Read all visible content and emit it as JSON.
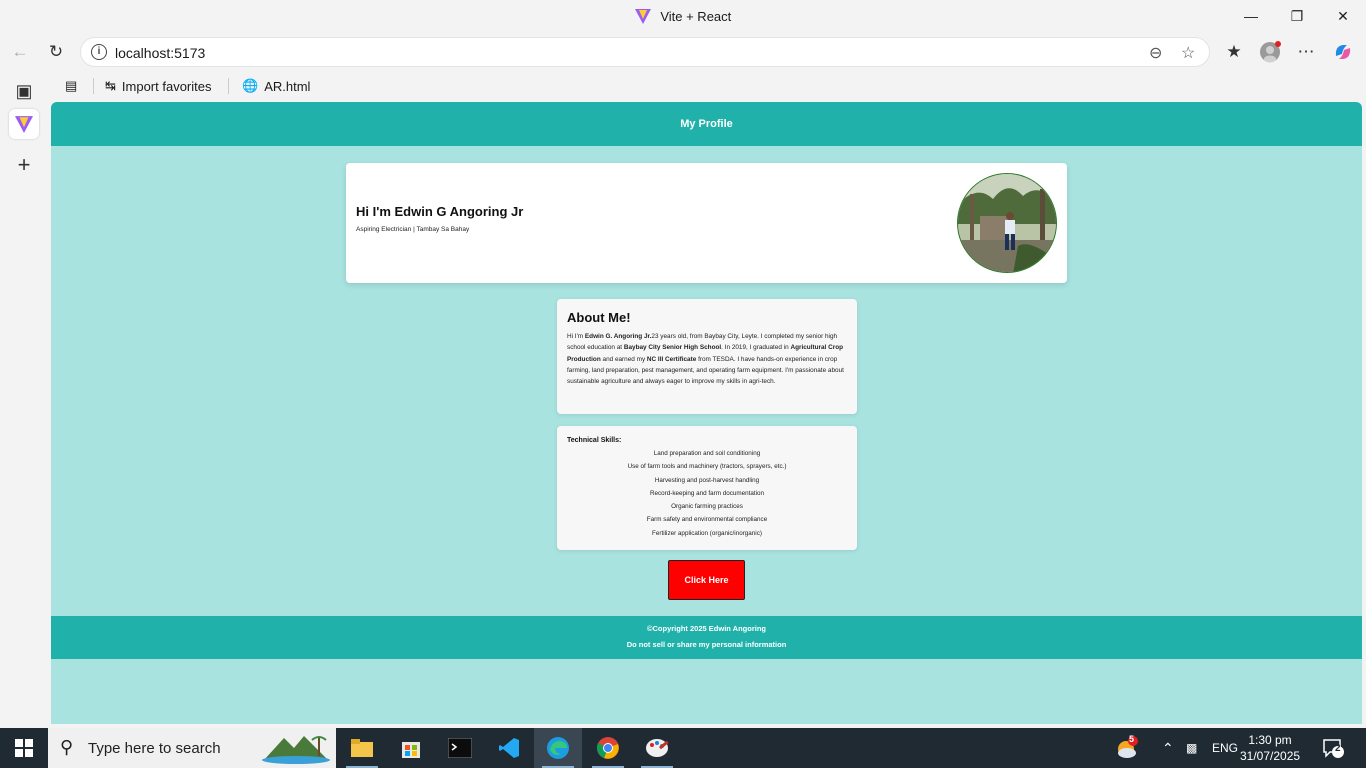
{
  "browser": {
    "window_title": "Vite + React",
    "url": "localhost:5173",
    "favorites": [
      {
        "label": "Import favorites"
      },
      {
        "label": "AR.html"
      }
    ],
    "icons": {
      "back": "arrow-left-icon",
      "refresh": "refresh-icon",
      "info": "info-icon",
      "zoom": "zoom-out-icon",
      "favorite": "star-icon",
      "collections": "favorites-icon",
      "profile": "avatar-icon",
      "more": "more-icon",
      "copilot": "copilot-icon"
    }
  },
  "page": {
    "header_title": "My Profile",
    "hero": {
      "name": "Hi I'm Edwin G Angoring Jr",
      "tagline": "Aspiring Electrician | Tambay Sa Bahay"
    },
    "about": {
      "heading": "About Me!",
      "segments": [
        {
          "text": "Hi I'm ",
          "bold": false
        },
        {
          "text": "Edwin G. Angoring Jr.",
          "bold": true
        },
        {
          "text": "23 years old, from Baybay City, Leyte. I completed my senior high school education at ",
          "bold": false
        },
        {
          "text": "Baybay City Senior High School",
          "bold": true
        },
        {
          "text": ". In 2019, I graduated in ",
          "bold": false
        },
        {
          "text": "Agricultural Crop Production",
          "bold": true
        },
        {
          "text": " and earned my ",
          "bold": false
        },
        {
          "text": "NC III Certificate",
          "bold": true
        },
        {
          "text": " from TESDA. I have hands-on experience in crop farming, land preparation, pest management, and operating farm equipment. I'm passionate about sustainable agriculture and always eager to improve my skills in agri-tech.",
          "bold": false
        }
      ]
    },
    "skills": {
      "heading": "Technical Skills:",
      "items": [
        "Land preparation and soil conditioning",
        "Use of farm tools and machinery (tractors, sprayers, etc.)",
        "Harvesting and post-harvest handling",
        "Record-keeping and farm documentation",
        "Organic farming practices",
        "Farm safety and environmental compliance",
        "Fertilizer application (organic/inorganic)"
      ]
    },
    "cta_label": "Click Here",
    "footer": {
      "copyright": "©Copyright 2025 Edwin Angoring",
      "privacy": "Do not sell or share my personal information"
    },
    "colors": {
      "header": "#20b2aa",
      "background": "#a8e3df",
      "cta": "#ff0000"
    }
  },
  "taskbar": {
    "search_placeholder": "Type here to search",
    "language": "ENG",
    "time": "1:30 pm",
    "date": "31/07/2025",
    "weather_badge": "5",
    "notification_count": "2"
  }
}
